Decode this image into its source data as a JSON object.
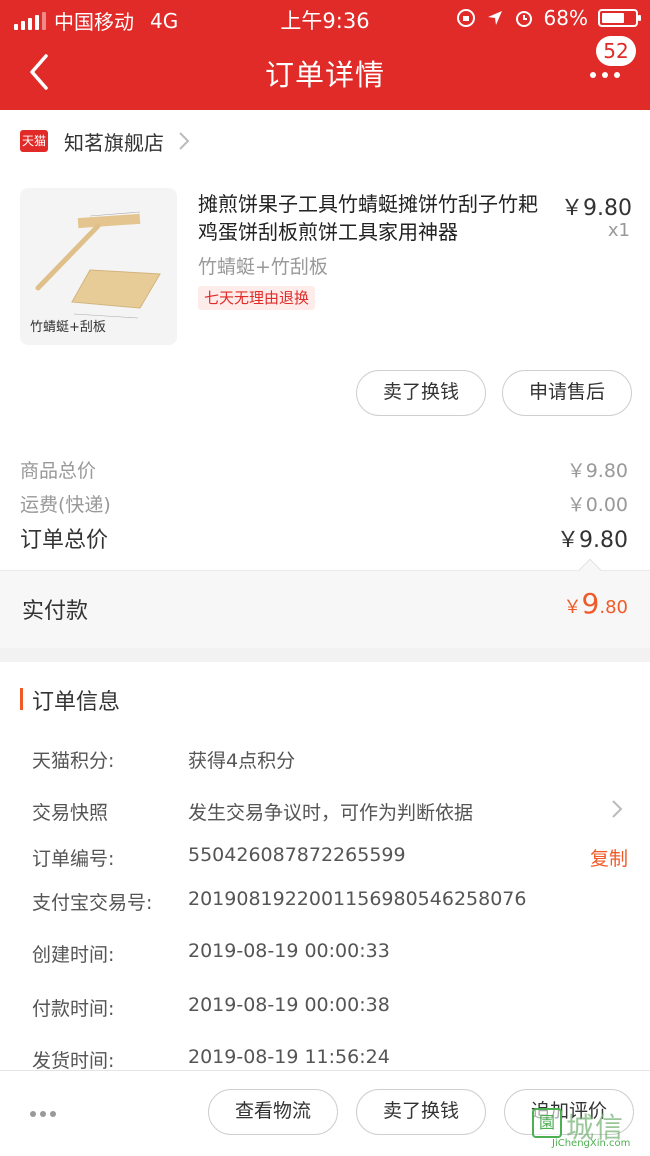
{
  "status_bar": {
    "carrier": "中国移动",
    "network": "4G",
    "time": "上午9:36",
    "battery": "68%"
  },
  "header": {
    "title": "订单详情",
    "badge": "52"
  },
  "store": {
    "logo_text": "天猫",
    "name": "知茗旗舰店"
  },
  "product": {
    "name": "摊煎饼果子工具竹蜻蜓摊饼竹刮子竹耙鸡蛋饼刮板煎饼工具家用神器",
    "price": "￥9.80",
    "quantity": "x1",
    "sku": "竹蜻蜓+竹刮板",
    "tag": "七天无理由退换",
    "image_caption": "竹蜻蜓+刮板"
  },
  "item_actions": {
    "sell": "卖了换钱",
    "after_sale": "申请售后"
  },
  "summary": {
    "goods_label": "商品总价",
    "goods_value": "￥9.80",
    "shipping_label": "运费(快递)",
    "shipping_value": "￥0.00",
    "total_label": "订单总价",
    "total_value": "￥9.80"
  },
  "paid": {
    "label": "实付款",
    "currency": "￥",
    "integer": "9",
    "decimal": ".80"
  },
  "order_info": {
    "title": "订单信息",
    "points_label": "天猫积分:",
    "points_value": "获得4点积分",
    "snapshot_label": "交易快照",
    "snapshot_value": "发生交易争议时，可作为判断依据",
    "order_no_label": "订单编号:",
    "order_no_value": "550426087872265599",
    "copy_label": "复制",
    "alipay_label": "支付宝交易号:",
    "alipay_value": "2019081922001156980546258076",
    "created_label": "创建时间:",
    "created_value": "2019-08-19 00:00:33",
    "paid_label": "付款时间:",
    "paid_value": "2019-08-19 00:00:38",
    "shipped_label": "发货时间:",
    "shipped_value": "2019-08-19 11:56:24"
  },
  "bottom_bar": {
    "logistics": "查看物流",
    "sell": "卖了换钱",
    "review": "追加评价"
  },
  "watermark": {
    "glyph": "園",
    "chars": "城信",
    "url": "JiChengXin.com"
  },
  "colors": {
    "brand_red": "#e02b28",
    "accent_orange": "#f05a28"
  }
}
